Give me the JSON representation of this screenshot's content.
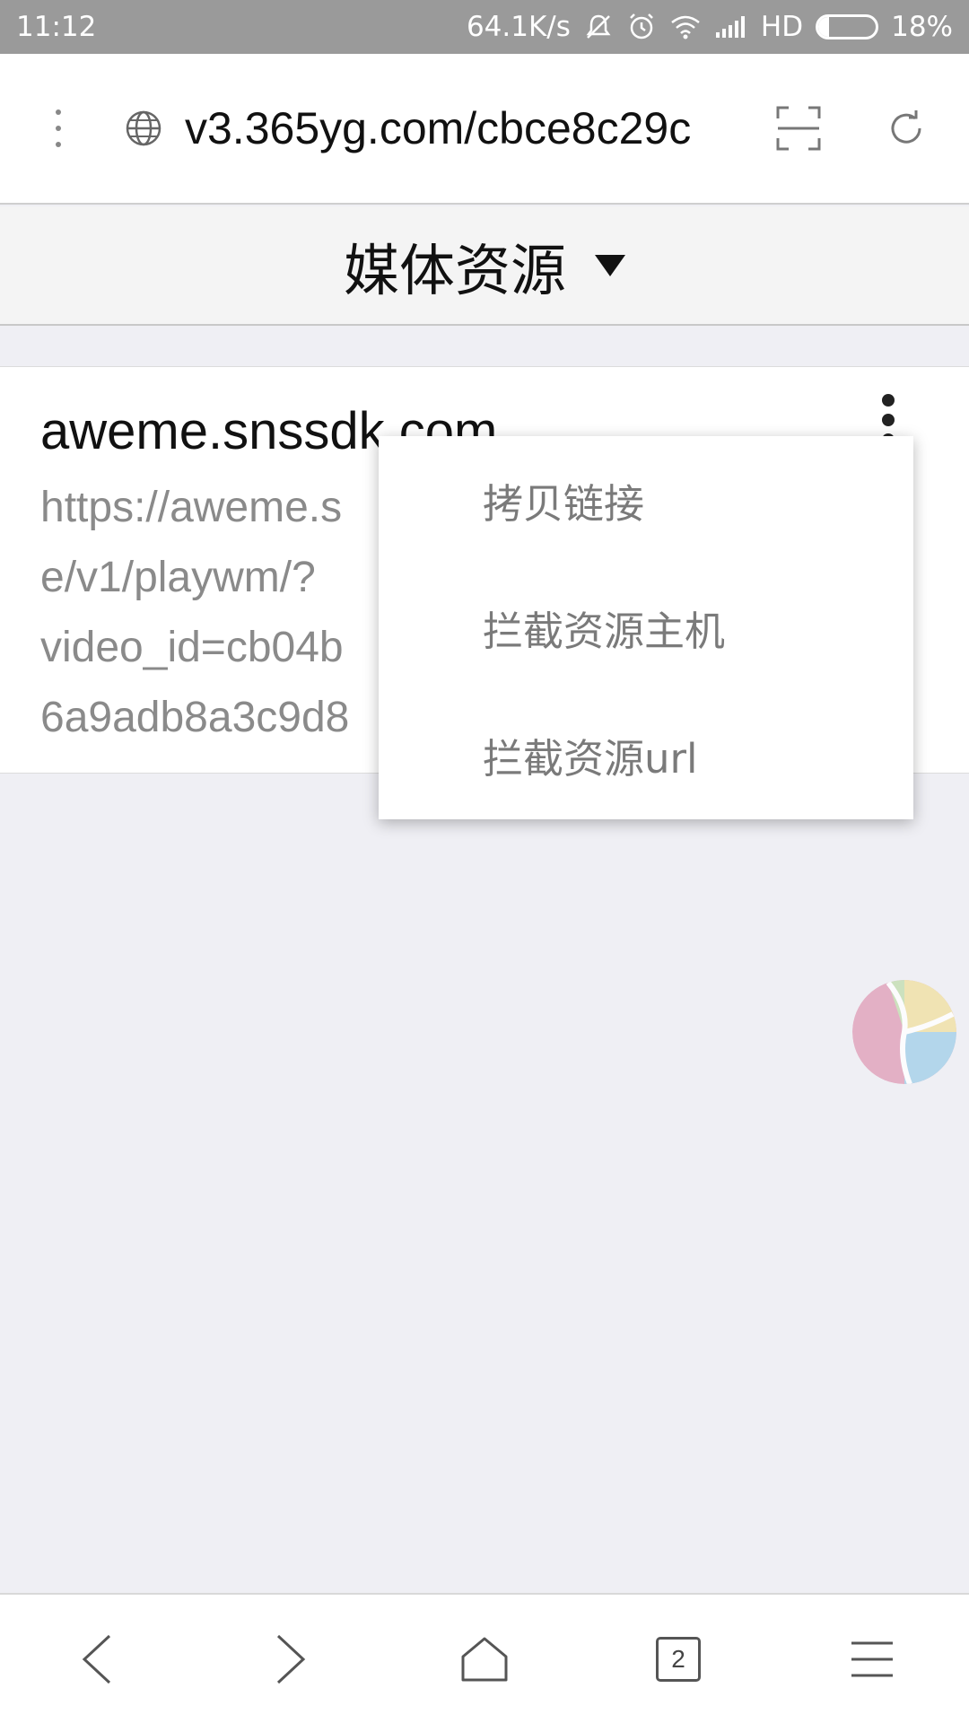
{
  "status_bar": {
    "time": "11:12",
    "net_speed": "64.1K/s",
    "network": "HD",
    "battery": "18%",
    "battery_level": 0.18
  },
  "browser": {
    "url": "v3.365yg.com/cbce8c29c",
    "icons": [
      "more-vertical-icon",
      "globe-icon",
      "scan-icon",
      "reload-icon"
    ]
  },
  "section": {
    "title": "媒体资源"
  },
  "resource": {
    "host": "aweme.snssdk.com",
    "url_lines": [
      "https://aweme.s",
      "e/v1/playwm/?",
      "video_id=cb04b",
      "6a9adb8a3c9d8"
    ]
  },
  "context_menu": {
    "items": [
      {
        "label": "拷贝链接"
      },
      {
        "label": "拦截资源主机"
      },
      {
        "label": "拦截资源url"
      }
    ]
  },
  "bottom_nav": {
    "tab_count": "2",
    "icons": [
      "back-icon",
      "forward-icon",
      "home-icon",
      "tabs-icon",
      "menu-icon"
    ]
  },
  "colors": {
    "status_bar": "#9a9a9a",
    "background": "#efeff4",
    "secondary_text": "#8a8a8a"
  }
}
